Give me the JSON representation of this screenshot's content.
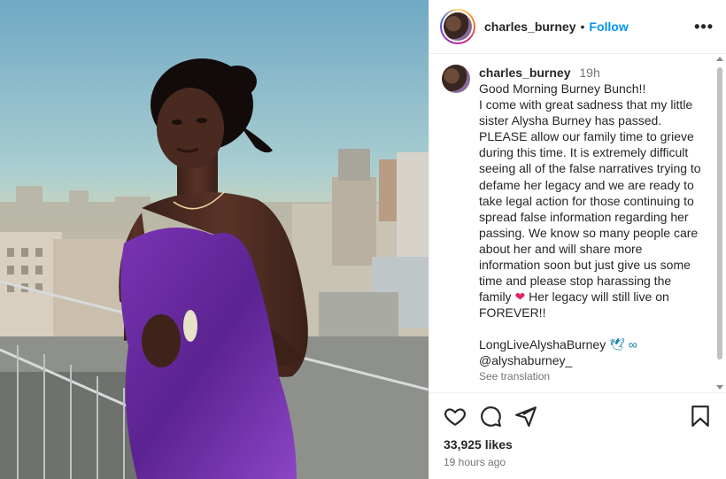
{
  "post": {
    "username": "charles_burney",
    "separator": "•",
    "follow_label": "Follow",
    "more_label": "•••",
    "photo_alt": "Photo of a woman in a purple strapless dress on a rooftop"
  },
  "caption": {
    "username": "charles_burney",
    "time": "19h",
    "text": "Good Morning Burney Bunch!!\nI come with great sadness that my little sister Alysha Burney has passed. PLEASE allow our family time to grieve during this time. It is extremely difficult seeing all of the false narratives trying to defame her legacy and we are ready to take legal action for those continuing to spread false information regarding her passing. We know so many people care about her and will share more information soon but just give us some time and please stop harassing the family ",
    "heart": "❤",
    "text_after": " Her legacy will still live on FOREVER!!",
    "tag_text": "LongLiveAlyshaBurney ",
    "tag_emojis": "🕊 ∞",
    "mention": "@alyshaburney_",
    "see_translation": "See translation"
  },
  "actions": {
    "icons": [
      "heart-icon",
      "comment-icon",
      "share-icon",
      "bookmark-icon"
    ],
    "likes": "33,925 likes",
    "ago": "19 hours ago"
  },
  "colors": {
    "follow": "#0095f6",
    "dress": "#6a2a9c",
    "sky_top": "#7fb6cc",
    "sky_bottom": "#f1d7a0"
  }
}
